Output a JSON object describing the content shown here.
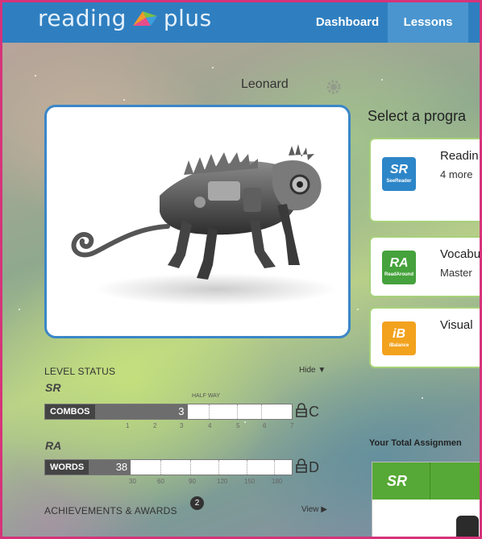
{
  "brand": {
    "logo_text_left": "reading",
    "logo_text_right": "plus"
  },
  "nav": {
    "items": [
      "Dashboard",
      "Lessons"
    ]
  },
  "profile": {
    "username": "Leonard"
  },
  "level_status": {
    "title": "LEVEL STATUS",
    "hide_label": "Hide",
    "halfway_label": "HALF WAY",
    "seereader": {
      "logo": "SR",
      "bar_label": "COMBOS",
      "value": "3",
      "progress_fraction": 0.4286,
      "ticks": [
        "1",
        "2",
        "3",
        "4",
        "5",
        "6",
        "7"
      ],
      "grade": "C"
    },
    "readaround": {
      "logo": "RA",
      "bar_label": "WORDS",
      "value": "38",
      "progress_fraction": 0.2111,
      "ticks": [
        "30",
        "60",
        "90",
        "120",
        "150",
        "180"
      ],
      "grade": "D"
    }
  },
  "achievements": {
    "title": "ACHIEVEMENTS & AWARDS",
    "count": "2",
    "view_label": "View"
  },
  "programs": {
    "heading": "Select a progra",
    "items": [
      {
        "icon_big": "SR",
        "icon_small": "SeeReader",
        "title": "Readin",
        "subtitle": "4 more",
        "color": "#2d86c8"
      },
      {
        "icon_big": "RA",
        "icon_small": "ReadAround",
        "title": "Vocabu",
        "subtitle": "Master",
        "color": "#45a23c"
      },
      {
        "icon_big": "iB",
        "icon_small": "iBalance",
        "title": "Visual",
        "subtitle": "",
        "color": "#f2a21d"
      }
    ]
  },
  "assignments": {
    "heading": "Your Total Assignmen",
    "column_logo": "SR"
  }
}
